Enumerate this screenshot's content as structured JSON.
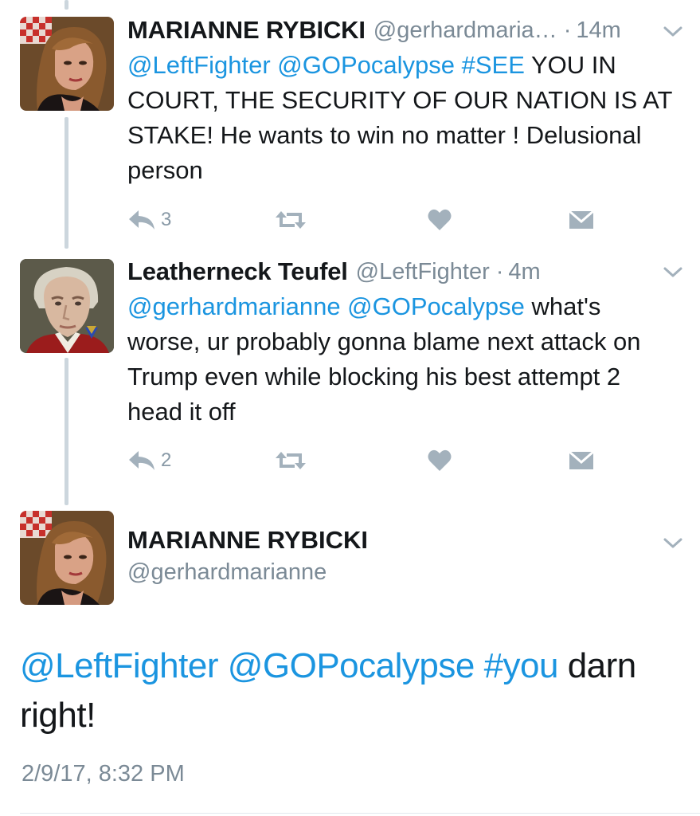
{
  "tweets": [
    {
      "name": "MARIANNE RYBICKI",
      "handle": "@gerhardmaria…",
      "dot": "·",
      "time": "14m",
      "text_parts": [
        {
          "text": "@LeftFighter @GOPocalypse #SEE",
          "link": true
        },
        {
          "text": " YOU IN COURT, THE SECURITY OF OUR NATION IS AT STAKE! He wants to win no matter ! Delusional person",
          "link": false
        }
      ],
      "reply_count": "3"
    },
    {
      "name": "Leatherneck Teufel",
      "handle": "@LeftFighter",
      "dot": "·",
      "time": "4m",
      "text_parts": [
        {
          "text": "@gerhardmarianne @GOPocalypse",
          "link": true
        },
        {
          "text": " what's worse, ur probably gonna blame  next attack on Trump even while blocking his best attempt 2 head it off",
          "link": false
        }
      ],
      "reply_count": "2"
    }
  ],
  "focused": {
    "name": "MARIANNE RYBICKI",
    "handle": "@gerhardmarianne",
    "text_parts": [
      {
        "text": "@LeftFighter @GOPocalypse #you",
        "link": true
      },
      {
        "text": " darn right!",
        "link": false
      }
    ],
    "date": "2/9/17, 8:32 PM"
  },
  "icons": {
    "reply": "reply-icon",
    "retweet": "retweet-icon",
    "like": "heart-icon",
    "dm": "envelope-icon",
    "more": "chevron-down-icon"
  },
  "colors": {
    "link": "#1b95e0",
    "secondary_text": "#7b8a96",
    "icon_gray": "#a3b1bc",
    "thread_line": "#ccd6dd"
  }
}
